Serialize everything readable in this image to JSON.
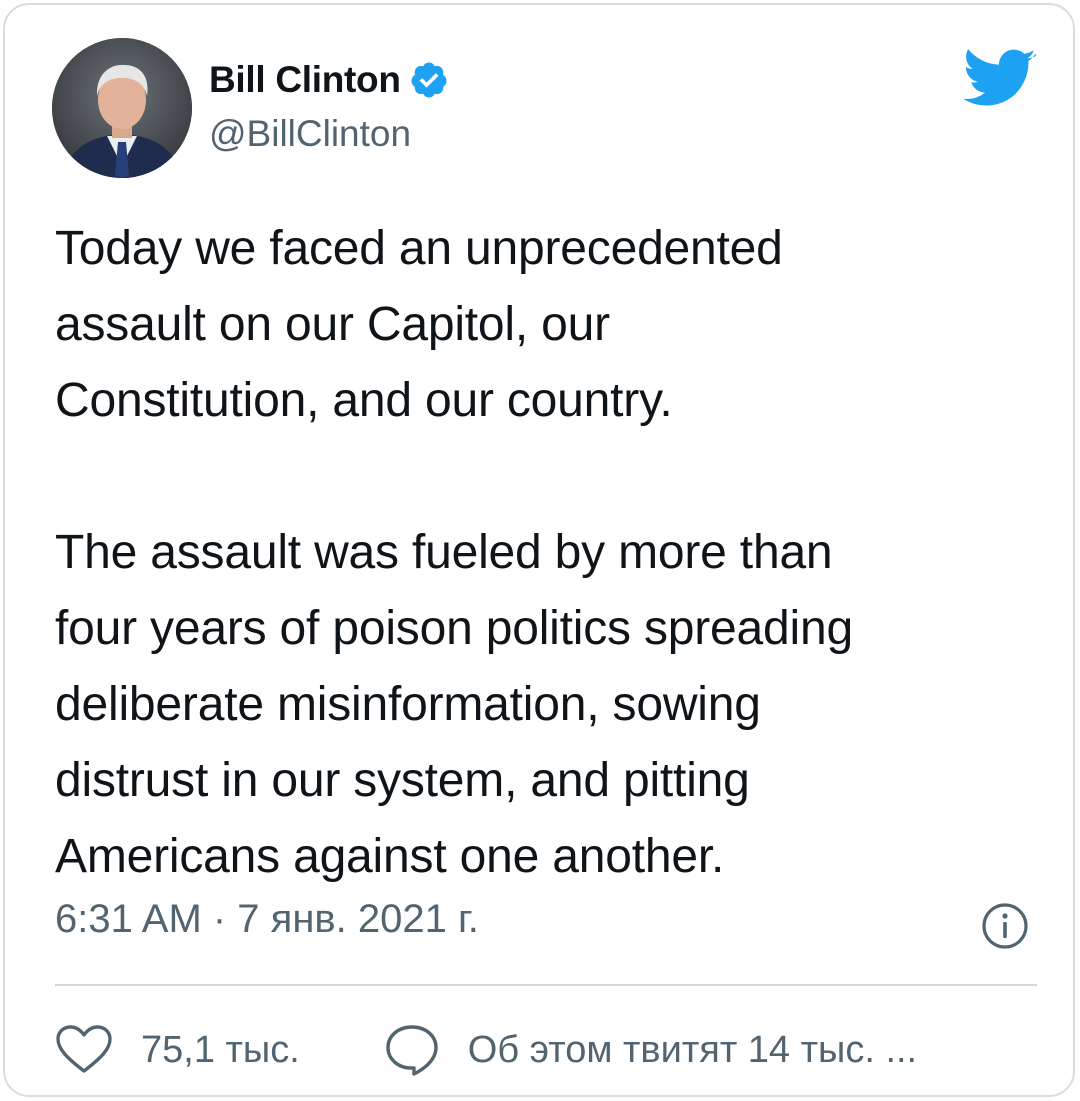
{
  "author": {
    "display_name": "Bill Clinton",
    "handle": "@BillClinton",
    "verified": true
  },
  "tweet": {
    "text": "Today we faced an unprecedented\nassault on our Capitol, our\nConstitution, and our country.\n\nThe assault was fueled by more than\nfour years of poison politics spreading\ndeliberate misinformation, sowing\ndistrust in our system, and pitting\nAmericans against one another.",
    "timestamp": "6:31 AM · 7 янв. 2021 г."
  },
  "actions": {
    "likes_label": "75,1 тыс.",
    "replies_label": "Об этом твитят 14 тыс. ..."
  },
  "icons": {
    "brand": "twitter-bird-icon",
    "verified": "verified-badge-icon",
    "info": "info-icon",
    "like": "heart-icon",
    "reply": "speech-bubble-icon"
  },
  "colors": {
    "brand": "#1da1f2",
    "text_primary": "#0f1419",
    "text_secondary": "#536471",
    "border": "#cfd9de"
  }
}
